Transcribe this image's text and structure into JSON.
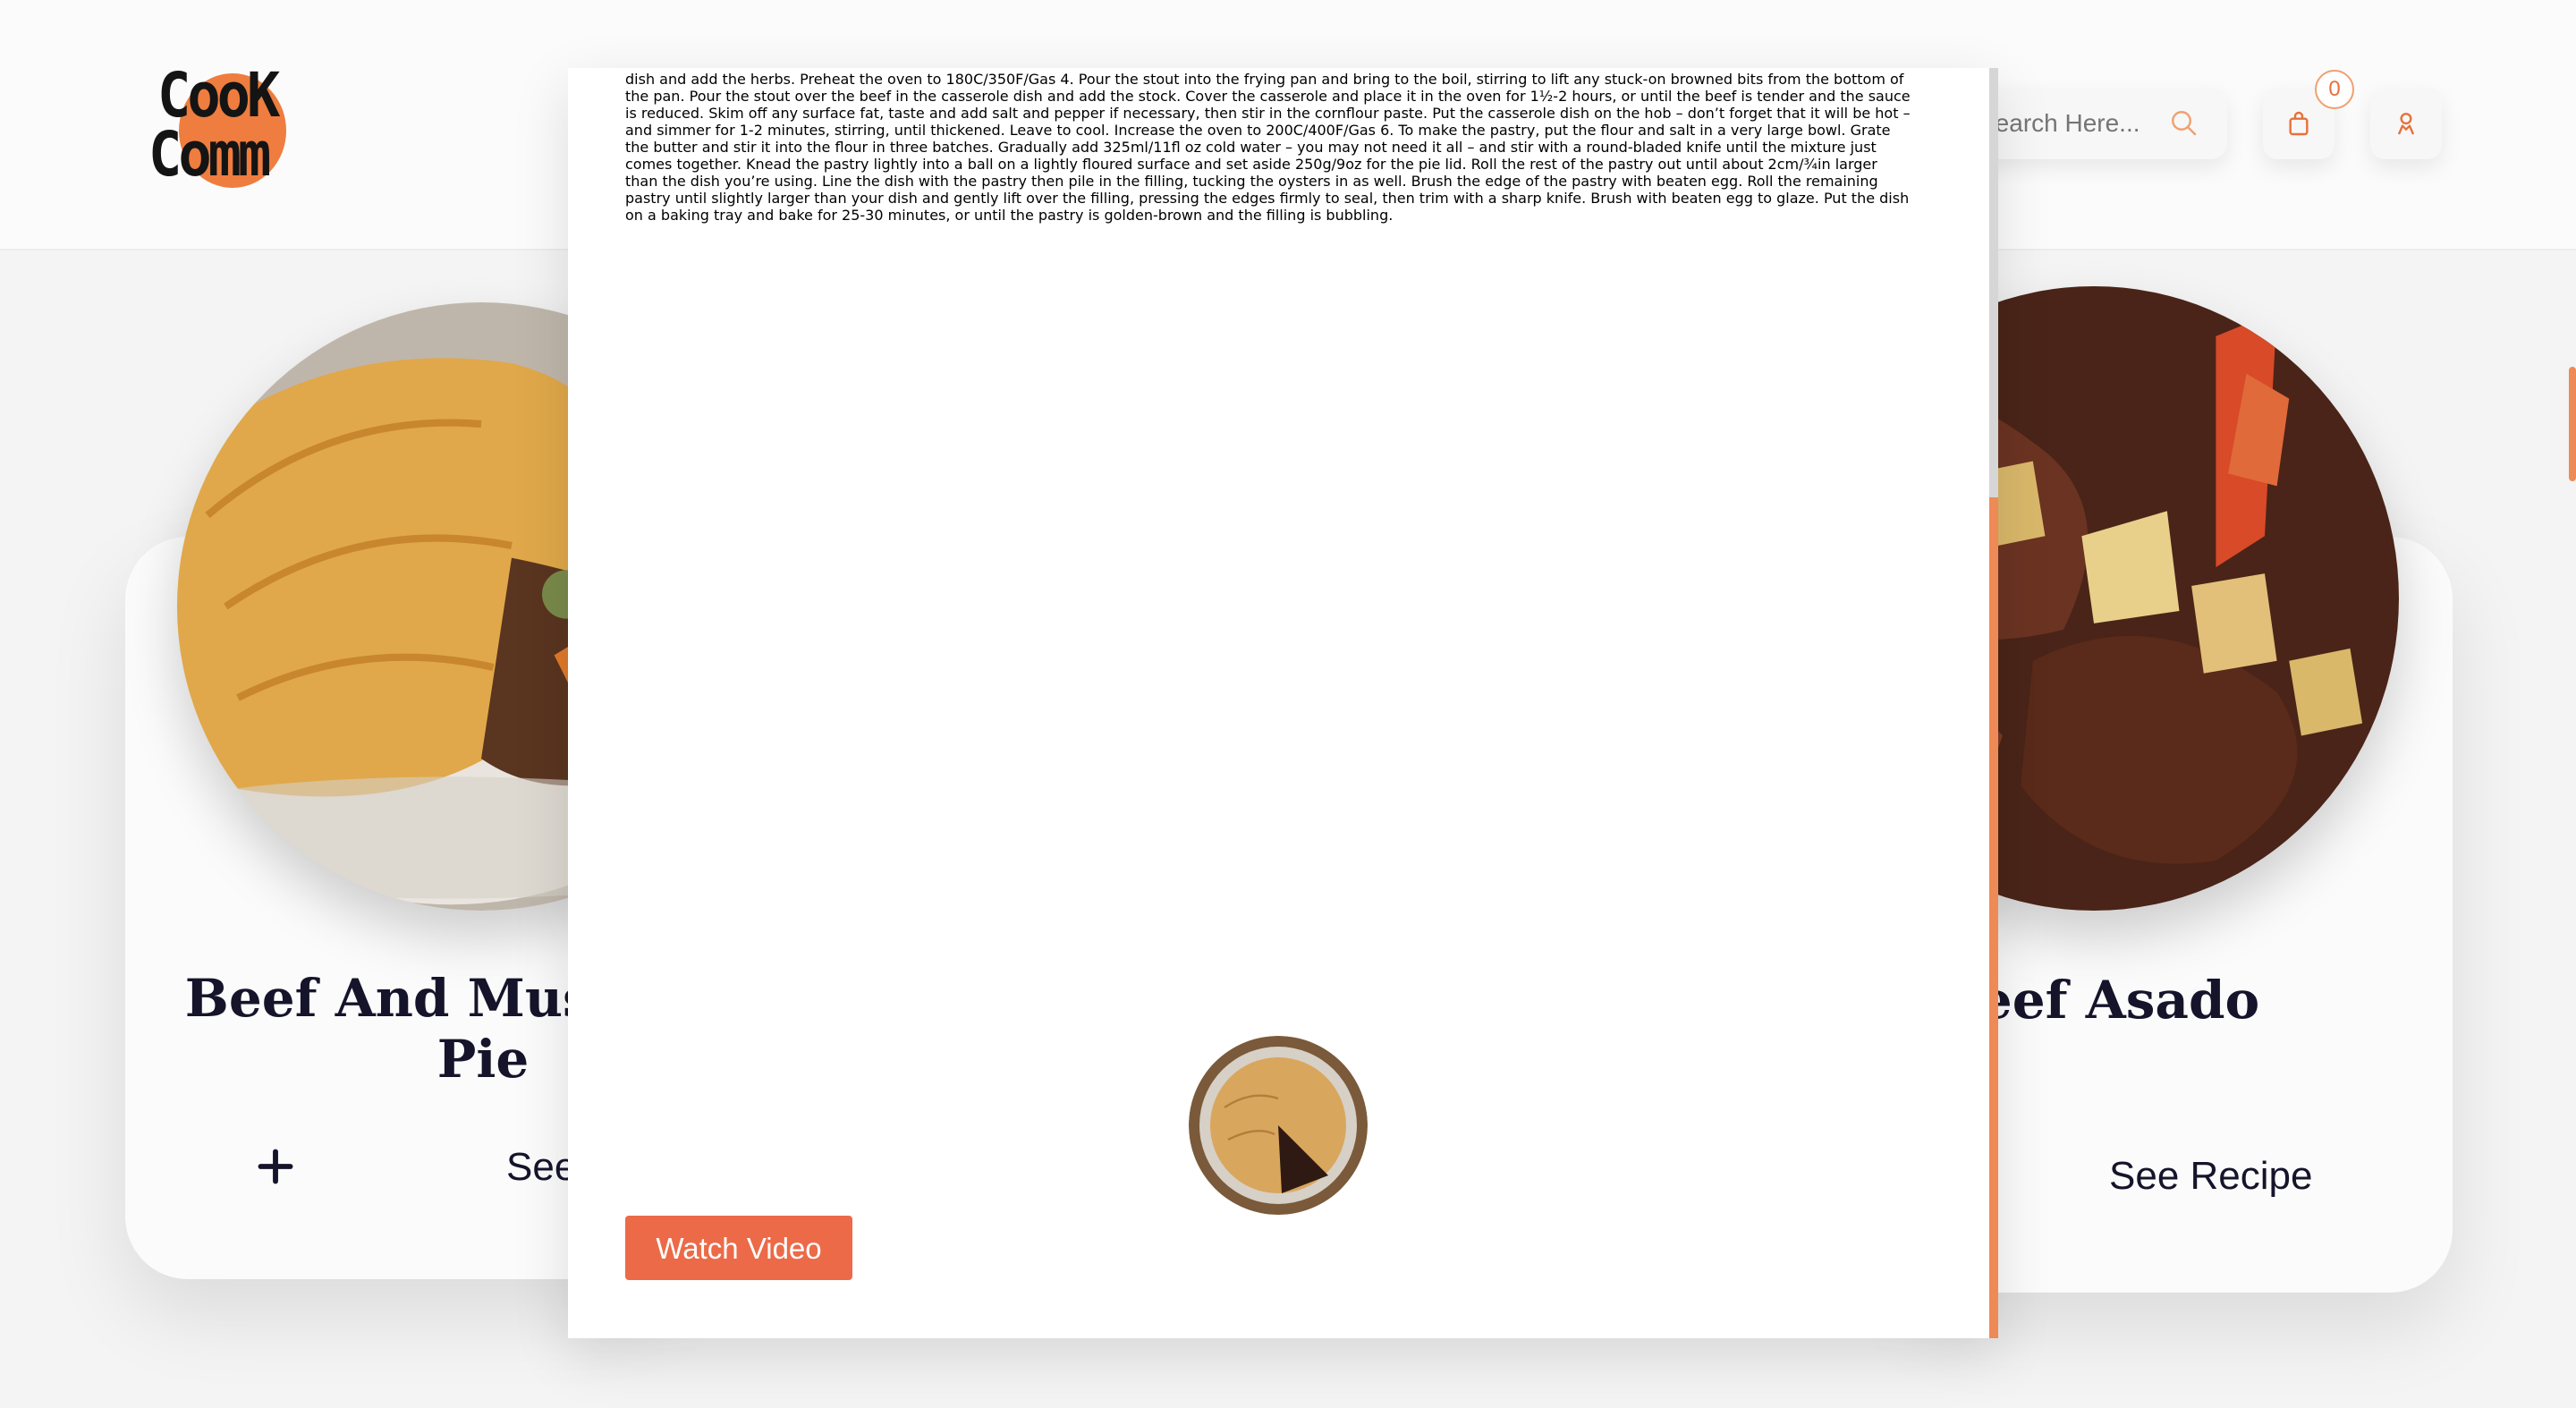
{
  "header": {
    "logo_line1": "CooK",
    "logo_line2": "Comm",
    "search_placeholder": "Search Here...",
    "cart_count": "0"
  },
  "cards": {
    "left": {
      "title": "Beef And Mushroom Pie",
      "see_label": "See Recipe",
      "add_symbol": "+"
    },
    "right": {
      "title": "Beef Asado",
      "see_label": "See Recipe"
    }
  },
  "modal": {
    "method_text": "dish and add the herbs. Preheat the oven to 180C/350F/Gas 4. Pour the stout into the frying pan and bring to the boil, stirring to lift any stuck-on browned bits from the bottom of the pan. Pour the stout over the beef in the casserole dish and add the stock. Cover the casserole and place it in the oven for 1½-2 hours, or until the beef is tender and the sauce is reduced. Skim off any surface fat, taste and add salt and pepper if necessary, then stir in the cornflour paste. Put the casserole dish on the hob – don’t forget that it will be hot – and simmer for 1-2 minutes, stirring, until thickened. Leave to cool. Increase the oven to 200C/400F/Gas 6. To make the pastry, put the flour and salt in a very large bowl. Grate the butter and stir it into the flour in three batches. Gradually add 325ml/11fl oz cold water – you may not need it all – and stir with a round-bladed knife until the mixture just comes together. Knead the pastry lightly into a ball on a lightly floured surface and set aside 250g/9oz for the pie lid. Roll the rest of the pastry out until about 2cm/¾in larger than the dish you’re using. Line the dish with the pastry then pile in the filling, tucking the oysters in as well. Brush the edge of the pastry with beaten egg. Roll the remaining pastry until slightly larger than your dish and gently lift over the filling, pressing the edges firmly to seal, then trim with a sharp knife. Brush with beaten egg to glaze. Put the dish on a baking tray and bake for 25-30 minutes, or until the pastry is golden-brown and the filling is bubbling.",
    "watch_button": "Watch Video"
  },
  "colors": {
    "accent": "#ec6a48",
    "logo_orange": "#ee7d3f",
    "title": "#15142b"
  },
  "icons": {
    "search": "search-icon",
    "cart": "shopping-bag-icon",
    "user": "user-icon",
    "add": "plus-icon"
  }
}
